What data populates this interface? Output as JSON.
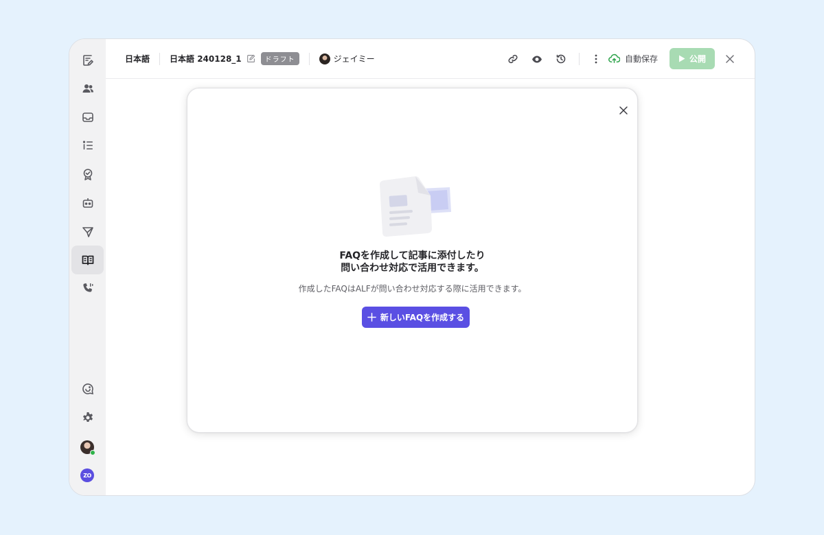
{
  "topbar": {
    "language": "日本語",
    "doc_title": "日本語 240128_1",
    "status_badge": "ドラフト",
    "author_name": "ジェイミー",
    "autosave_label": "自動保存",
    "publish_label": "公開"
  },
  "empty_state": {
    "title_line1": "FAQを作成して記事に添付したり",
    "title_line2": "問い合わせ対応で活用できます。",
    "description": "作成したFAQはALFが問い合わせ対応する際に活用できます。",
    "create_button_label": "新しいFAQを作成する"
  },
  "sidebar": {
    "items": [
      "compose-icon",
      "users-icon",
      "inbox-icon",
      "list-icon",
      "badge-check-icon",
      "bot-icon",
      "send-icon",
      "book-icon",
      "phone-icon",
      "support-icon",
      "gear-icon"
    ],
    "active_item": "book-icon",
    "brand_logo": "ZO"
  },
  "colors": {
    "primary": "#5a4fe3",
    "publish_disabled": "#a8dbb3",
    "autosave_green": "#2fa44c",
    "background": "#e5f2fd"
  }
}
